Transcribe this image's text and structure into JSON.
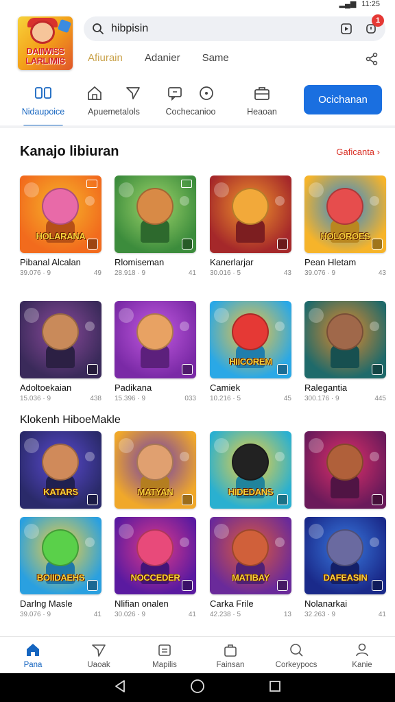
{
  "status": {
    "time": "11:25"
  },
  "search": {
    "query": "hibpisin",
    "notification_count": "1"
  },
  "subtabs": [
    {
      "label": "Afiurain",
      "active": true
    },
    {
      "label": "Adanier",
      "active": false
    },
    {
      "label": "Same",
      "active": false
    }
  ],
  "categories": [
    {
      "label": "Nidaupoice",
      "icon": "cards-icon",
      "active": true
    },
    {
      "label": "Apuemetalols",
      "icon": "home-icon",
      "active": false
    },
    {
      "label": "Cochecanioo",
      "icon": "chat-icon",
      "active": false
    },
    {
      "label": "Heaoan",
      "icon": "briefcase-icon",
      "active": false
    }
  ],
  "cta_label": "Ocichanan",
  "section1": {
    "title": "Kanajo libiuran",
    "more": "Gaficanta"
  },
  "section2": {
    "title": "Klokenh HiboeMakle"
  },
  "games": [
    {
      "name": "Pibanal Alcalan",
      "meta": "39.076 · 9",
      "rating": "49",
      "banner": "HOLARANA",
      "c1": "#f26b1d",
      "c2": "#f5b52a",
      "char": "#e86aa8"
    },
    {
      "name": "Rlomiseman",
      "meta": "28.918 · 9",
      "rating": "41",
      "banner": "",
      "c1": "#3c8c3c",
      "c2": "#9fd56b",
      "char": "#d88a46"
    },
    {
      "name": "Kanerlarjar",
      "meta": "30.016 · 5",
      "rating": "43",
      "banner": "",
      "c1": "#a5282a",
      "c2": "#f0962c",
      "char": "#f2a93a"
    },
    {
      "name": "Pean Hletam",
      "meta": "39.076 · 9",
      "rating": "43",
      "banner": "HOLOROES",
      "c1": "#f6b42a",
      "c2": "#2a86d8",
      "char": "#e64d4d"
    },
    {
      "name": "Adoltoekaian",
      "meta": "15.036 · 9",
      "rating": "438",
      "banner": "",
      "c1": "#3a2a5a",
      "c2": "#8a4a9a",
      "char": "#c98a5a"
    },
    {
      "name": "Padikana",
      "meta": "15.396 · 9",
      "rating": "033",
      "banner": "",
      "c1": "#7a2aa6",
      "c2": "#c25ae0",
      "char": "#e8a263"
    },
    {
      "name": "Camiek",
      "meta": "10.216 · 5",
      "rating": "45",
      "banner": "HIICOREM",
      "c1": "#2aa8e6",
      "c2": "#f5c33a",
      "char": "#e53935"
    },
    {
      "name": "Ralegantia",
      "meta": "300.176 · 9",
      "rating": "445",
      "banner": "",
      "c1": "#1f6a6a",
      "c2": "#e58a2a",
      "char": "#a0684a"
    },
    {
      "name": "",
      "meta": "",
      "rating": "",
      "banner": "KATARS",
      "c1": "#2a2a6a",
      "c2": "#5a4ad0",
      "char": "#d08a5a"
    },
    {
      "name": "",
      "meta": "",
      "rating": "",
      "banner": "MATYAN",
      "c1": "#f0a82a",
      "c2": "#6a3ab0",
      "char": "#e0a070"
    },
    {
      "name": "",
      "meta": "",
      "rating": "",
      "banner": "HIDEDANS",
      "c1": "#2ab0d0",
      "c2": "#f5d03a",
      "char": "#222222"
    },
    {
      "name": "",
      "meta": "",
      "rating": "",
      "banner": "",
      "c1": "#6a1a5a",
      "c2": "#e0306a",
      "char": "#b0603a"
    },
    {
      "name": "Darlng Masle",
      "meta": "39.076 · 9",
      "rating": "41",
      "banner": "BOIIDAEHS",
      "c1": "#2aa0e0",
      "c2": "#f5d03a",
      "char": "#5ad04a"
    },
    {
      "name": "Nlifian onalen",
      "meta": "30.026 · 9",
      "rating": "41",
      "banner": "NOCCEDER",
      "c1": "#5a1aa0",
      "c2": "#e03a8a",
      "char": "#e84a7a"
    },
    {
      "name": "Carka Frile",
      "meta": "42.238 · 5",
      "rating": "13",
      "banner": "MATIBAY",
      "c1": "#6a2a9a",
      "c2": "#e05a3a",
      "char": "#d0603a"
    },
    {
      "name": "Nolanarkai",
      "meta": "32.263 · 9",
      "rating": "41",
      "banner": "DAFEASIN",
      "c1": "#1a2a8a",
      "c2": "#3a7ae0",
      "char": "#6a6aa0"
    }
  ],
  "bottom_nav": [
    {
      "label": "Pana",
      "icon": "home-icon",
      "active": true
    },
    {
      "label": "Uaoak",
      "icon": "send-icon",
      "active": false
    },
    {
      "label": "Mapilis",
      "icon": "inbox-icon",
      "active": false
    },
    {
      "label": "Fainsan",
      "icon": "bag-icon",
      "active": false
    },
    {
      "label": "Corkeypocs",
      "icon": "search-icon",
      "active": false
    },
    {
      "label": "Kanie",
      "icon": "profile-icon",
      "active": false
    }
  ]
}
